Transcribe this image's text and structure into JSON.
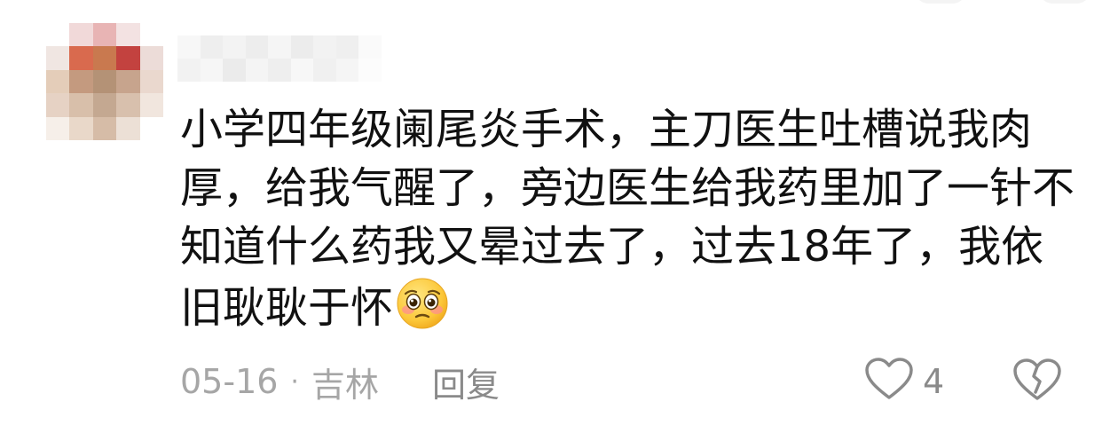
{
  "comment": {
    "text": "小学四年级阑尾炎手术，主刀医生吐槽说我肉厚，给我气醒了，旁边医生给我药里加了一针不知道什么药我又晕过去了，过去18年了，我依旧耿耿于怀",
    "emoji": "pleading-face-emoji"
  },
  "meta": {
    "date": "05-16",
    "separator": "·",
    "location": "吉林",
    "reply_label": "回复"
  },
  "actions": {
    "like_icon": "heart-outline-icon",
    "like_count": "4",
    "dislike_icon": "broken-heart-icon"
  },
  "colors": {
    "text": "#111111",
    "meta": "#a6a6a6",
    "icon": "#8a8a8a"
  }
}
